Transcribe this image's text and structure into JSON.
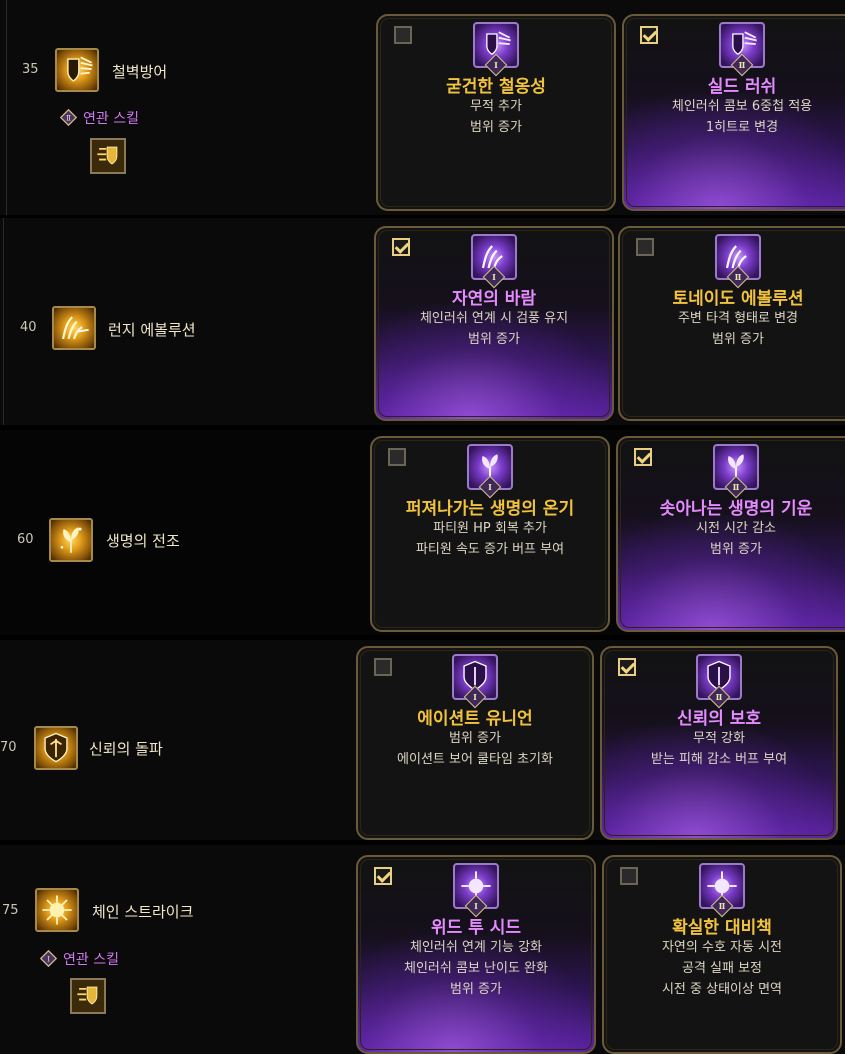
{
  "rows": [
    {
      "level": "35",
      "skill_name": "철벽방어",
      "related": {
        "tier": "Ⅱ",
        "label": "연관 스킬"
      },
      "cards": [
        {
          "tier": "Ⅰ",
          "title": "굳건한 철옹성",
          "selected": false,
          "desc": [
            "무적 추가",
            "범위 증가"
          ]
        },
        {
          "tier": "Ⅱ",
          "title": "실드 러쉬",
          "selected": true,
          "desc": [
            "체인러쉬 콤보 6중첩 적용",
            "1히트로 변경"
          ]
        }
      ]
    },
    {
      "level": "40",
      "skill_name": "런지 에볼루션",
      "cards": [
        {
          "tier": "Ⅰ",
          "title": "자연의 바람",
          "selected": true,
          "desc": [
            "체인러쉬 연계 시 검풍 유지",
            "범위 증가"
          ]
        },
        {
          "tier": "Ⅱ",
          "title": "토네이도 에볼루션",
          "selected": false,
          "desc": [
            "주변 타격 형태로 변경",
            "범위 증가"
          ]
        }
      ]
    },
    {
      "level": "60",
      "skill_name": "생명의 전조",
      "cards": [
        {
          "tier": "Ⅰ",
          "title": "퍼져나가는 생명의 온기",
          "selected": false,
          "desc": [
            "파티원 HP 회복 추가",
            "파티원 속도 증가 버프 부여"
          ]
        },
        {
          "tier": "Ⅱ",
          "title": "솟아나는 생명의 기운",
          "selected": true,
          "desc": [
            "시전 시간 감소",
            "범위 증가"
          ]
        }
      ]
    },
    {
      "level": "70",
      "skill_name": "신뢰의 돌파",
      "cards": [
        {
          "tier": "Ⅰ",
          "title": "에이션트 유니언",
          "selected": false,
          "desc": [
            "범위 증가",
            "에이션트 보어 쿨타임 초기화"
          ]
        },
        {
          "tier": "Ⅱ",
          "title": "신뢰의 보호",
          "selected": true,
          "desc": [
            "무적 강화",
            "받는 피해 감소 버프 부여"
          ]
        }
      ]
    },
    {
      "level": "75",
      "skill_name": "체인 스트라이크",
      "related": {
        "tier": "Ⅰ",
        "label": "연관 스킬"
      },
      "cards": [
        {
          "tier": "Ⅰ",
          "title": "위드 투 시드",
          "selected": true,
          "desc": [
            "체인러쉬 연계 기능 강화",
            "체인러쉬 콤보 난이도 완화",
            "범위 증가"
          ]
        },
        {
          "tier": "Ⅱ",
          "title": "확실한 대비책",
          "selected": false,
          "desc": [
            "자연의 수호 자동 시전",
            "공격 실패 보정",
            "시전 중 상태이상 면역"
          ]
        }
      ]
    }
  ],
  "icons": {
    "skills": [
      "shield-wing-icon",
      "claw-slash-icon",
      "sprout-icon",
      "crest-shield-icon",
      "flower-strike-icon"
    ],
    "mini": "shield-icon"
  },
  "colors": {
    "gold_title": "#f2c33c",
    "purple_title": "#e58bff",
    "card_border": "#6a5a3a",
    "related": "#d278f2"
  }
}
